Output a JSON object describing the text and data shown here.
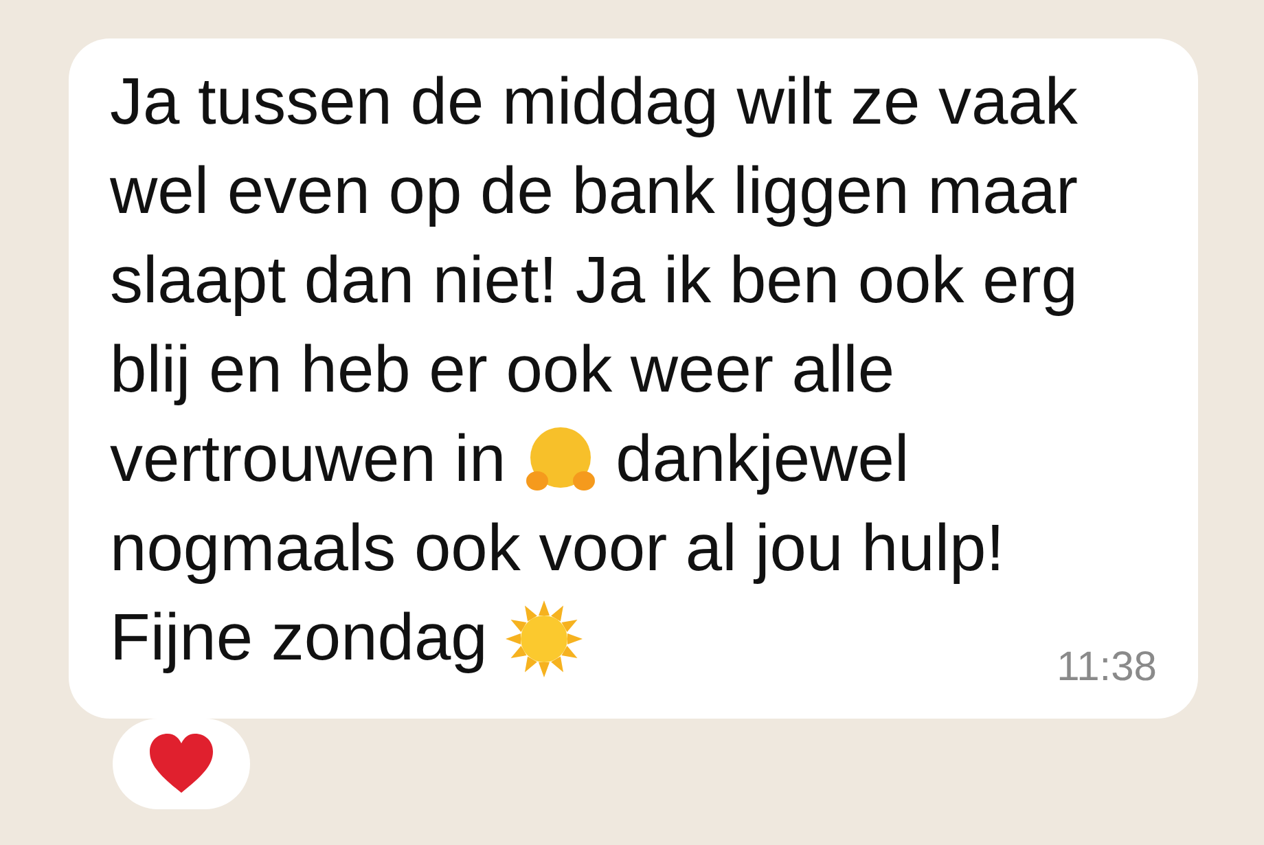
{
  "message": {
    "lines": [
      [
        {
          "kind": "text",
          "text": "Ja tussen de middag wilt ze vaak"
        }
      ],
      [
        {
          "kind": "text",
          "text": "wel even op de bank liggen maar"
        }
      ],
      [
        {
          "kind": "text",
          "text": "slaapt dan niet! Ja ik ben ook erg"
        }
      ],
      [
        {
          "kind": "text",
          "text": "blij en heb er ook weer alle"
        }
      ],
      [
        {
          "kind": "text",
          "text": "vertrouwen in"
        },
        {
          "kind": "hug"
        },
        {
          "kind": "text",
          "text": "dankjewel"
        }
      ],
      [
        {
          "kind": "text",
          "text": "nogmaals ook voor al jou hulp!"
        }
      ],
      [
        {
          "kind": "text",
          "text": "Fijne zondag"
        },
        {
          "kind": "sun"
        }
      ]
    ],
    "time": "11:38",
    "reactions": [
      {
        "kind": "heart"
      }
    ]
  }
}
